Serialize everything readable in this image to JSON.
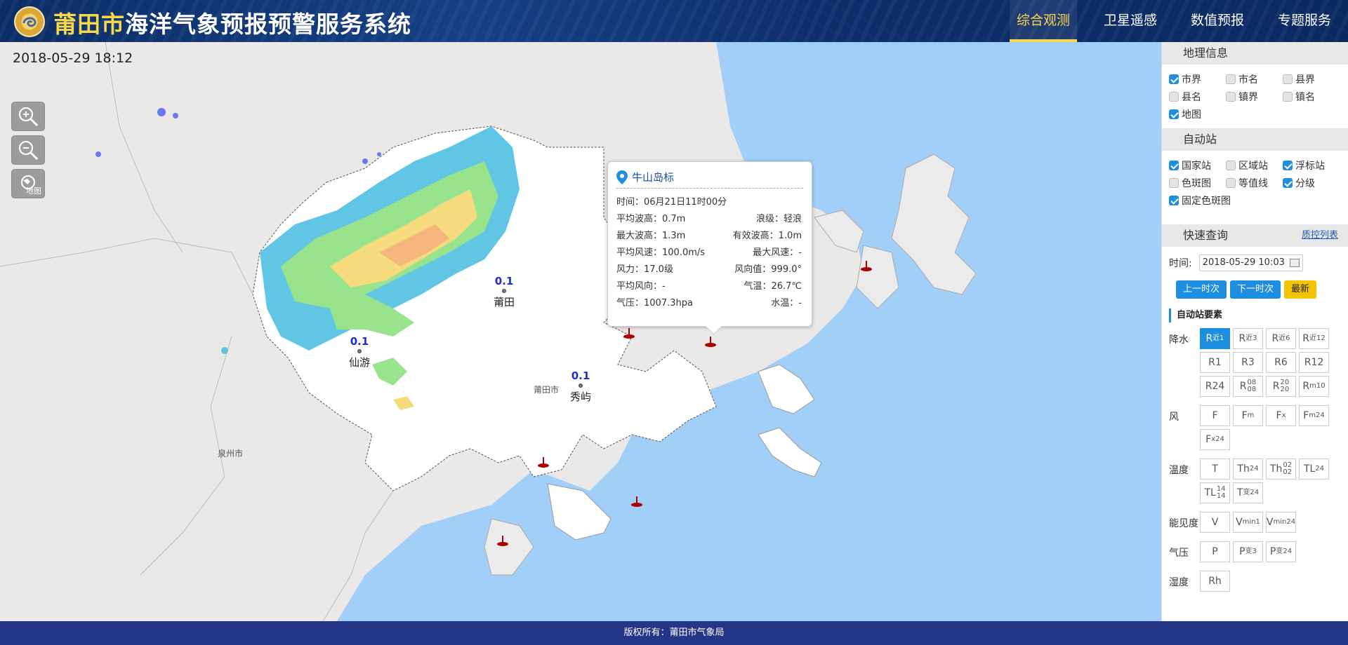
{
  "header": {
    "title_city": "莆田市",
    "title_rest": "海洋气象预报预警服务系统",
    "nav": [
      {
        "label": "综合观测",
        "active": true
      },
      {
        "label": "卫星遥感",
        "active": false
      },
      {
        "label": "数值预报",
        "active": false
      },
      {
        "label": "专题服务",
        "active": false
      }
    ]
  },
  "map": {
    "timestamp": "2018-05-29 18:12",
    "tool_map_label": "地图",
    "stations": [
      {
        "name": "莆田",
        "value": "0.1"
      },
      {
        "name": "仙游",
        "value": "0.1"
      },
      {
        "name": "秀屿",
        "value": "0.1"
      }
    ],
    "labels": {
      "putian_city": "莆田市",
      "quanzhou_city": "泉州市"
    }
  },
  "popup": {
    "title": "牛山岛标",
    "time": "时间：06月21日11时00分",
    "rows": [
      [
        "平均波高：0.7m",
        "浪级：轻浪"
      ],
      [
        "最大波高：1.3m",
        "有效波高：1.0m"
      ],
      [
        "平均风速：100.0m/s",
        "最大风速：-"
      ],
      [
        "风力：17.0级",
        "风向值：999.0°"
      ],
      [
        "平均风向：-",
        "气温：26.7℃"
      ],
      [
        "气压：1007.3hpa",
        "水温：-"
      ]
    ]
  },
  "sidebar": {
    "geo_title": "地理信息",
    "geo_items": [
      {
        "label": "市界",
        "checked": true
      },
      {
        "label": "市名",
        "checked": false
      },
      {
        "label": "县界",
        "checked": false
      },
      {
        "label": "县名",
        "checked": false
      },
      {
        "label": "镇界",
        "checked": false
      },
      {
        "label": "镇名",
        "checked": false
      },
      {
        "label": "地图",
        "checked": true
      }
    ],
    "auto_title": "自动站",
    "auto_items": [
      {
        "label": "国家站",
        "checked": true
      },
      {
        "label": "区域站",
        "checked": false
      },
      {
        "label": "浮标站",
        "checked": true
      },
      {
        "label": "色斑图",
        "checked": false
      },
      {
        "label": "等值线",
        "checked": false
      },
      {
        "label": "分级",
        "checked": true
      },
      {
        "label": "固定色斑图",
        "checked": true
      }
    ],
    "quick_title": "快速查询",
    "qc_link": "质控列表",
    "time_label": "时间:",
    "time_value": "2018-05-29 10:03",
    "prev_button": "上一时次",
    "next_button": "下一时次",
    "latest_button": "最新",
    "elements_title": "自动站要素",
    "groups": [
      {
        "label": "降水",
        "buttons": [
          {
            "base": "R",
            "sub": "近1",
            "on": true
          },
          {
            "base": "R",
            "sub": "近3"
          },
          {
            "base": "R",
            "sub": "近6"
          },
          {
            "base": "R",
            "sub": "近12"
          },
          {
            "base": "R1"
          },
          {
            "base": "R3"
          },
          {
            "base": "R6"
          },
          {
            "base": "R12"
          },
          {
            "base": "R24"
          },
          {
            "base": "R",
            "sup": "08",
            "sub": "08"
          },
          {
            "base": "R",
            "sup": "20",
            "sub": "20"
          },
          {
            "base": "R",
            "sub": "m10"
          }
        ]
      },
      {
        "label": "风",
        "buttons": [
          {
            "base": "F"
          },
          {
            "base": "F",
            "sub": "m"
          },
          {
            "base": "F",
            "sub": "x"
          },
          {
            "base": "F",
            "sub": "m24"
          },
          {
            "base": "F",
            "sub": "x24"
          }
        ]
      },
      {
        "label": "温度",
        "buttons": [
          {
            "base": "T"
          },
          {
            "base": "Th",
            "sub": "24"
          },
          {
            "base": "Th",
            "sup": "02",
            "sub": "02"
          },
          {
            "base": "TL",
            "sub": "24"
          },
          {
            "base": "TL",
            "sup": "14",
            "sub": "14"
          },
          {
            "base": "T",
            "sub": "变24"
          }
        ]
      },
      {
        "label": "能见度",
        "buttons": [
          {
            "base": "V"
          },
          {
            "base": "V",
            "sub": "min1"
          },
          {
            "base": "V",
            "sub": "min24"
          }
        ]
      },
      {
        "label": "气压",
        "buttons": [
          {
            "base": "P"
          },
          {
            "base": "P",
            "sub": "变3"
          },
          {
            "base": "P",
            "sub": "变24"
          }
        ]
      },
      {
        "label": "湿度",
        "buttons": [
          {
            "base": "Rh"
          }
        ]
      }
    ]
  },
  "footer": {
    "text": "版权所有：莆田市气象局"
  },
  "colors": {
    "header_bg": "#163f86",
    "accent_yellow": "#f7d84a",
    "button_blue": "#1e8ee0",
    "sea": "#a2cff8",
    "footer_bg": "#253588"
  }
}
